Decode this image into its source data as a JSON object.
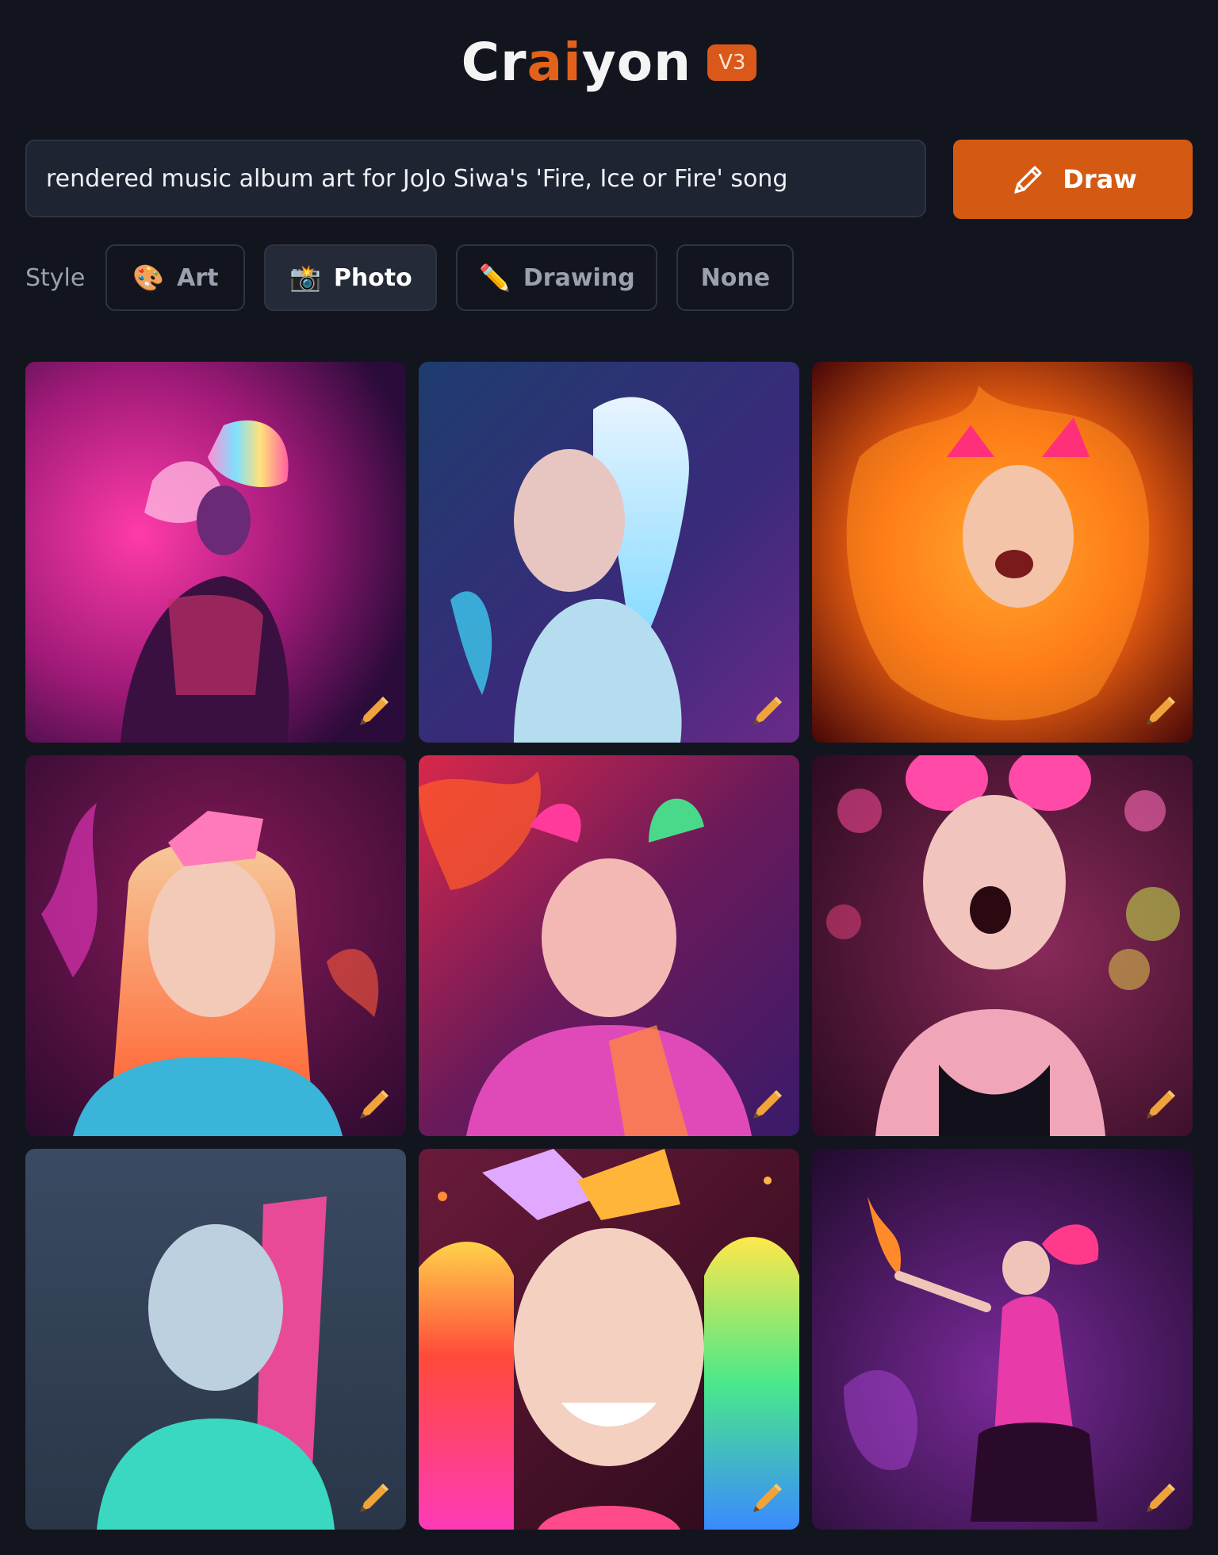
{
  "header": {
    "logo_pre": "Cr",
    "logo_accent": "ai",
    "logo_post": "yon",
    "version": "V3"
  },
  "prompt": {
    "value": "rendered music album art for JoJo Siwa's 'Fire, Ice or Fire' song"
  },
  "draw_button": {
    "label": "Draw",
    "icon": "pencil-icon"
  },
  "style": {
    "label": "Style",
    "options": [
      {
        "label": "Art",
        "icon": "palette-icon",
        "glyph": "🎨",
        "active": false
      },
      {
        "label": "Photo",
        "icon": "camera-flash-icon",
        "glyph": "📸",
        "active": true
      },
      {
        "label": "Drawing",
        "icon": "pencil-icon",
        "glyph": "✏️",
        "active": false
      },
      {
        "label": "None",
        "icon": "",
        "glyph": "",
        "active": false
      }
    ]
  },
  "results": {
    "count": 9,
    "edit_icon": "pencil-icon"
  },
  "colors": {
    "accent": "#d45a14",
    "background": "#12151e",
    "input_bg": "#1f2433"
  }
}
